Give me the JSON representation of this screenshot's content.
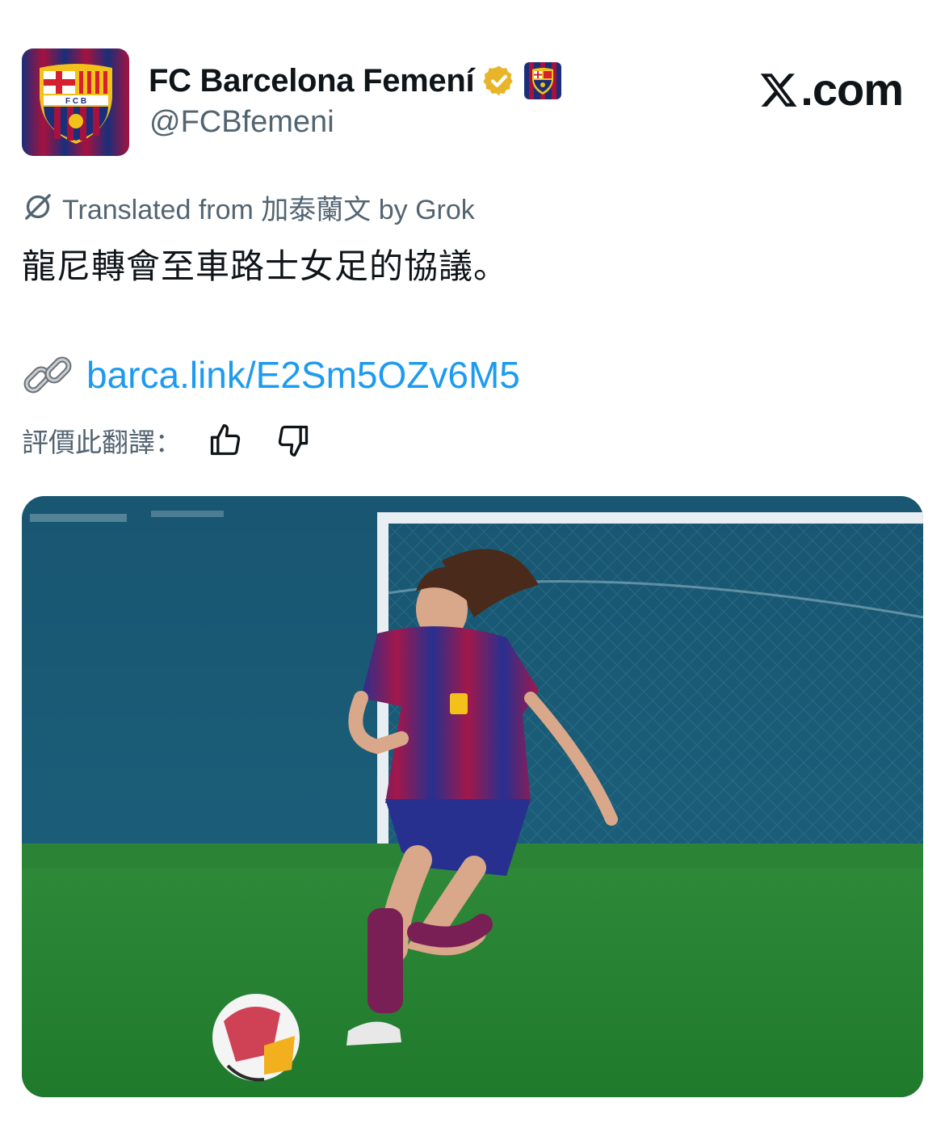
{
  "author": {
    "display_name": "FC Barcelona Femení",
    "handle": "@FCBfemeni",
    "avatar_icon": "fc-barcelona-crest-icon",
    "verified_icon": "gold-verified-badge-icon",
    "affiliate_icon": "fc-barcelona-affiliate-badge-icon"
  },
  "site": {
    "logo_text": ".com",
    "logo_icon": "x-logo-icon"
  },
  "translation": {
    "label": "Translated from 加泰蘭文 by Grok",
    "icon": "grok-icon"
  },
  "tweet": {
    "text": "龍尼轉會至車路士女足的協議。",
    "link_icon": "link-icon",
    "link_text": "barca.link/E2Sm5OZv6M5"
  },
  "rating": {
    "label": "評價此翻譯：",
    "thumbs_up_icon": "thumbs-up-icon",
    "thumbs_down_icon": "thumbs-down-icon"
  },
  "media": {
    "description_icon": "tweet-photo"
  },
  "colors": {
    "text_primary": "#0f1419",
    "text_secondary": "#536471",
    "link": "#1d9bf0",
    "barca_blue": "#1f3a8f",
    "barca_red": "#a50044",
    "verified_gold": "#e8b52a"
  }
}
